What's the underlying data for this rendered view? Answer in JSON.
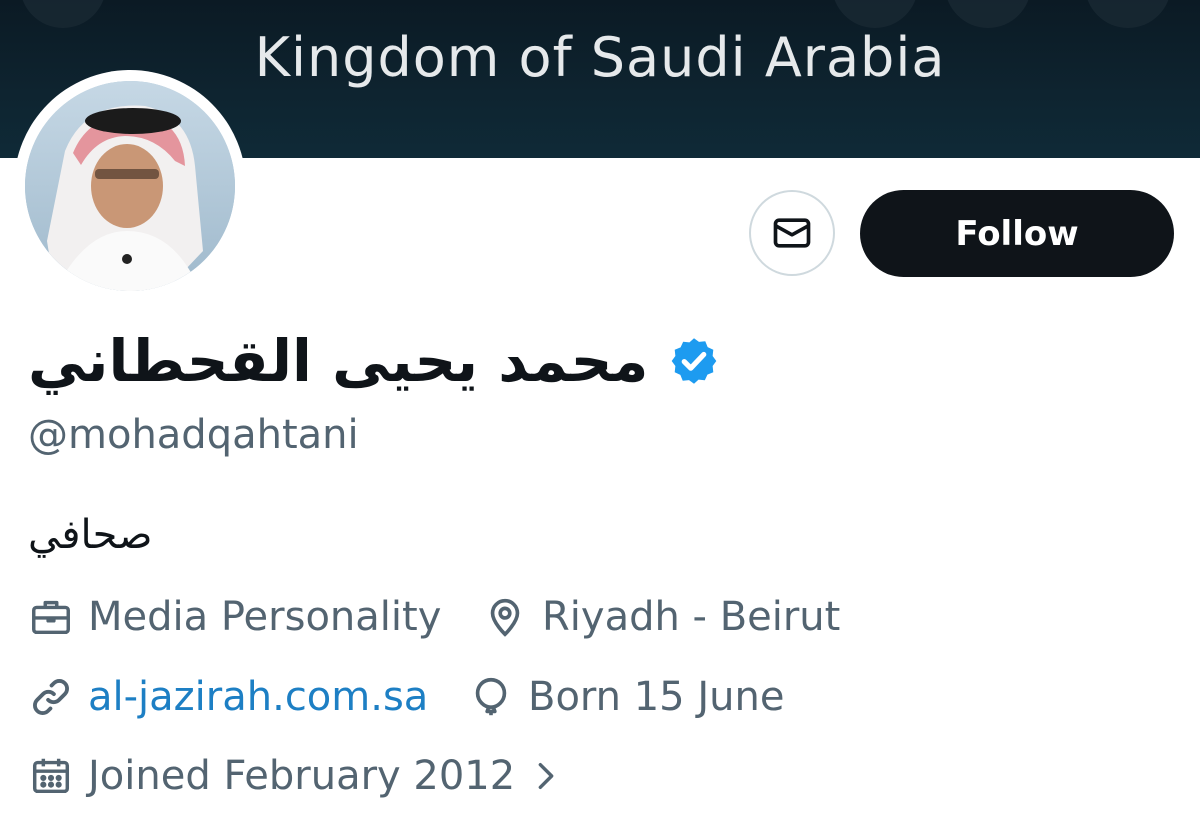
{
  "banner": {
    "text": "Kingdom of Saudi Arabia"
  },
  "profile": {
    "display_name": "محمد يحيى القحطاني",
    "handle": "@mohadqahtani",
    "bio": "صحافي",
    "verified": true,
    "category": "Media Personality",
    "location": "Riyadh - Beirut",
    "website": "al-jazirah.com.sa",
    "birthday": "Born 15 June",
    "joined": "Joined February 2012"
  },
  "actions": {
    "follow_label": "Follow",
    "message_icon": "mail-icon"
  },
  "colors": {
    "verified": "#1d9bf0",
    "link": "#1d7fc4",
    "primary_button": "#0f1419",
    "secondary_text": "#536471"
  }
}
